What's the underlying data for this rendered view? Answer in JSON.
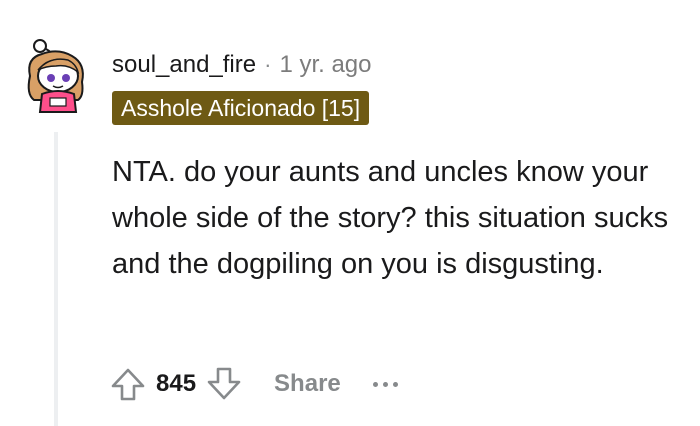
{
  "comment": {
    "username": "soul_and_fire",
    "separator": "·",
    "time": "1 yr. ago",
    "flair": "Asshole Aficionado [15]",
    "flair_color": "#6e5a14",
    "body": "NTA. do your aunts and uncles know your whole side of the story? this situation sucks and the dogpiling on you is disgusting.",
    "score": "845",
    "share_label": "Share",
    "avatar_icon": "snoo-avatar-icon",
    "upvote_icon": "upvote-arrow-icon",
    "downvote_icon": "downvote-arrow-icon",
    "more_icon": "more-options-icon"
  }
}
